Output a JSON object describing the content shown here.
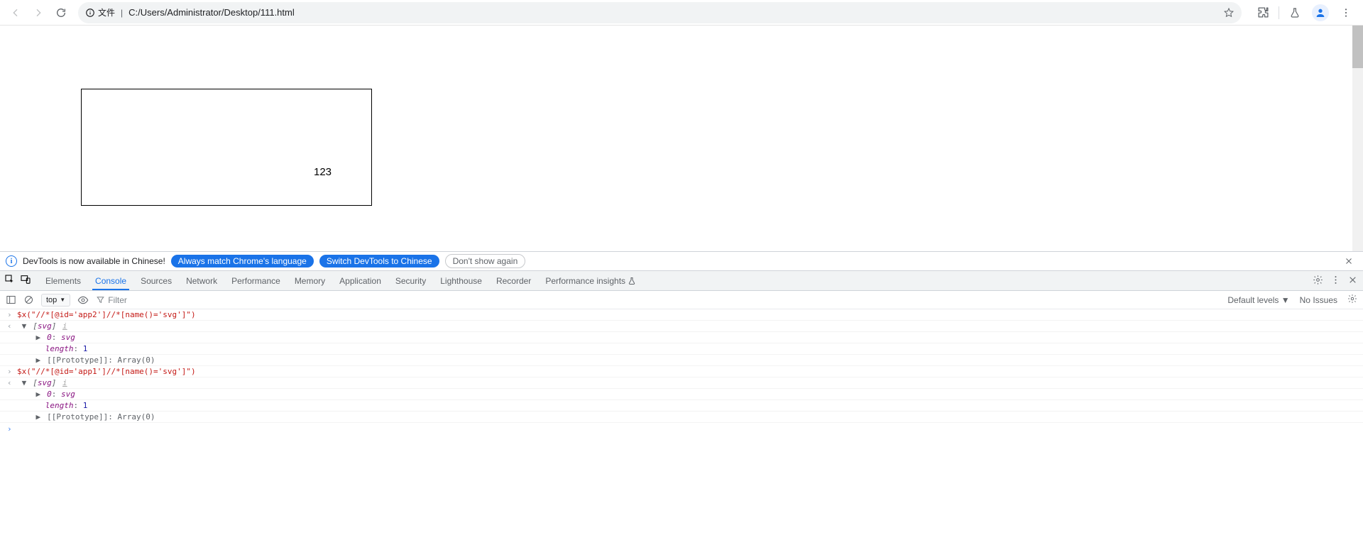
{
  "toolbar": {
    "url_prefix": "文件",
    "url": "C:/Users/Administrator/Desktop/111.html"
  },
  "page": {
    "box_text": "123"
  },
  "devtools": {
    "info": {
      "message": "DevTools is now available in Chinese!",
      "btn_always": "Always match Chrome's language",
      "btn_switch": "Switch DevTools to Chinese",
      "btn_dont": "Don't show again"
    },
    "tabs": [
      "Elements",
      "Console",
      "Sources",
      "Network",
      "Performance",
      "Memory",
      "Application",
      "Security",
      "Lighthouse",
      "Recorder",
      "Performance insights"
    ],
    "active_tab": 1,
    "console_toolbar": {
      "context": "top",
      "filter_placeholder": "Filter",
      "levels": "Default levels",
      "issues": "No Issues"
    },
    "console": {
      "cmd1": "$x(\"//*[@id='app2']//*[name()='svg']\")",
      "res_open": "[",
      "res_svg": "svg",
      "res_close": "]",
      "idx": "0",
      "len_key": "length",
      "len_val": "1",
      "proto": "[[Prototype]]",
      "proto_val": "Array(0)",
      "cmd2": "$x(\"//*[@id='app1']//*[name()='svg']\")",
      "info_i": "i"
    }
  }
}
